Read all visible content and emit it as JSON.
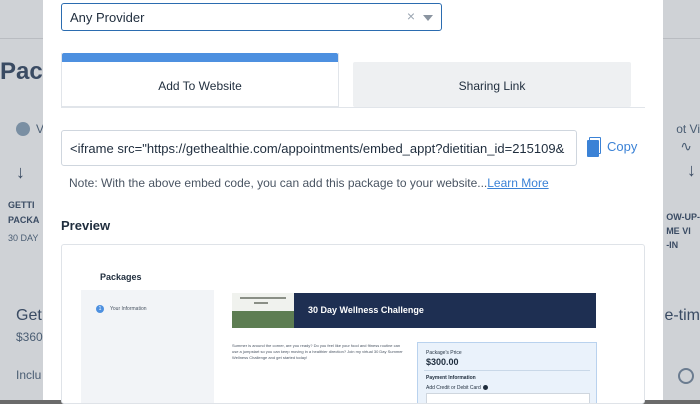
{
  "background": {
    "page_title": "Pack",
    "left_status_text": "V",
    "left_card": {
      "line1": "GETTI",
      "line2": "PACKA",
      "duration": "30 DAY",
      "bottom_title": "Get",
      "bottom_price": "$360",
      "include_text": "Inclu"
    },
    "right_status_text": "ot Vi",
    "right_card": {
      "line1": "OW-UP-",
      "line2": "ME VI",
      "line3": "-IN",
      "bottom_title": "e-tim"
    }
  },
  "modal": {
    "provider_select": {
      "value": "Any Provider",
      "clear_symbol": "×"
    },
    "tabs": [
      {
        "label": "Add To Website",
        "active": true
      },
      {
        "label": "Sharing Link",
        "active": false
      }
    ],
    "embed_code": "<iframe src=\"https://gethealthie.com/appointments/embed_appt?dietitian_id=215109&",
    "copy_label": "Copy",
    "note_text": "Note: With the above embed code, you can add this package to your website...",
    "note_link": "Learn More",
    "preview_heading": "Preview",
    "preview": {
      "title": "Packages",
      "step_number": "1",
      "step_label": "Your Information",
      "banner_title": "30 Day Wellness Challenge",
      "description": "Summer is around the corner, are you ready? Do you feel like your food and fitness routine can use a jumpstart so you can keep moving in a healthier direction? Join my virtual 30 Day Summer Wellness Challenge and get started today!",
      "price_label": "Package's Price",
      "price": "$300.00",
      "payment_heading": "Payment Information",
      "card_label": "Add Credit or Debit Card"
    }
  },
  "colors": {
    "accent": "#3b82d6",
    "tab_bar": "#4d90e0",
    "banner_navy": "#1e2f52",
    "overlay": "#6b6b6b"
  }
}
